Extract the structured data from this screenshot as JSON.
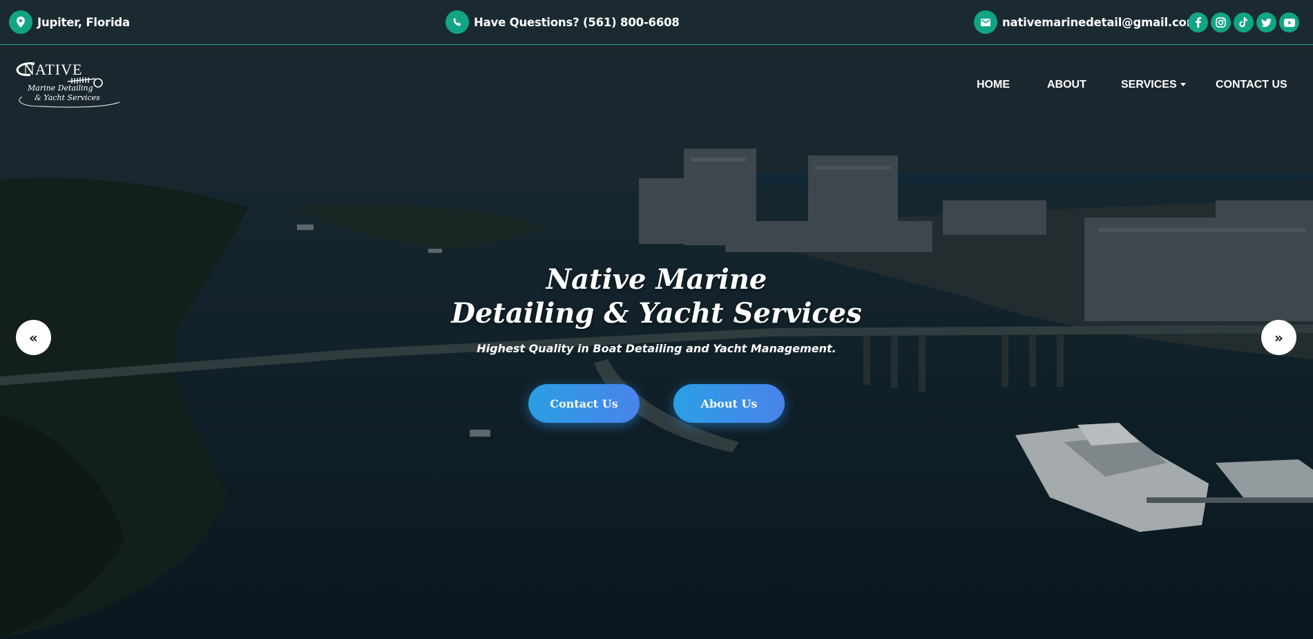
{
  "topbar": {
    "location": "Jupiter, Florida",
    "phone": "Have Questions? (561) 800-6608",
    "email": "nativemarinedetail@gmail.com",
    "socials": [
      "facebook-icon",
      "instagram-icon",
      "tiktok-icon",
      "twitter-icon",
      "youtube-icon"
    ]
  },
  "logo": {
    "line1": "NATIVE",
    "line2": "Marine Detailing",
    "line3": "& Yacht Services"
  },
  "nav": {
    "home": "HOME",
    "about": "ABOUT",
    "services": "SERVICES",
    "contact": "CONTACT US"
  },
  "hero": {
    "title_line1": "Native Marine",
    "title_line2": "Detailing & Yacht Services",
    "subtitle": "Highest Quality in Boat Detailing and Yacht Management.",
    "btn_contact": "Contact Us",
    "btn_about": "About Us",
    "prev": "«",
    "next": "»"
  },
  "colors": {
    "accent": "#11a585",
    "button": "#2a9fe4",
    "topbar": "#1b2a31"
  }
}
